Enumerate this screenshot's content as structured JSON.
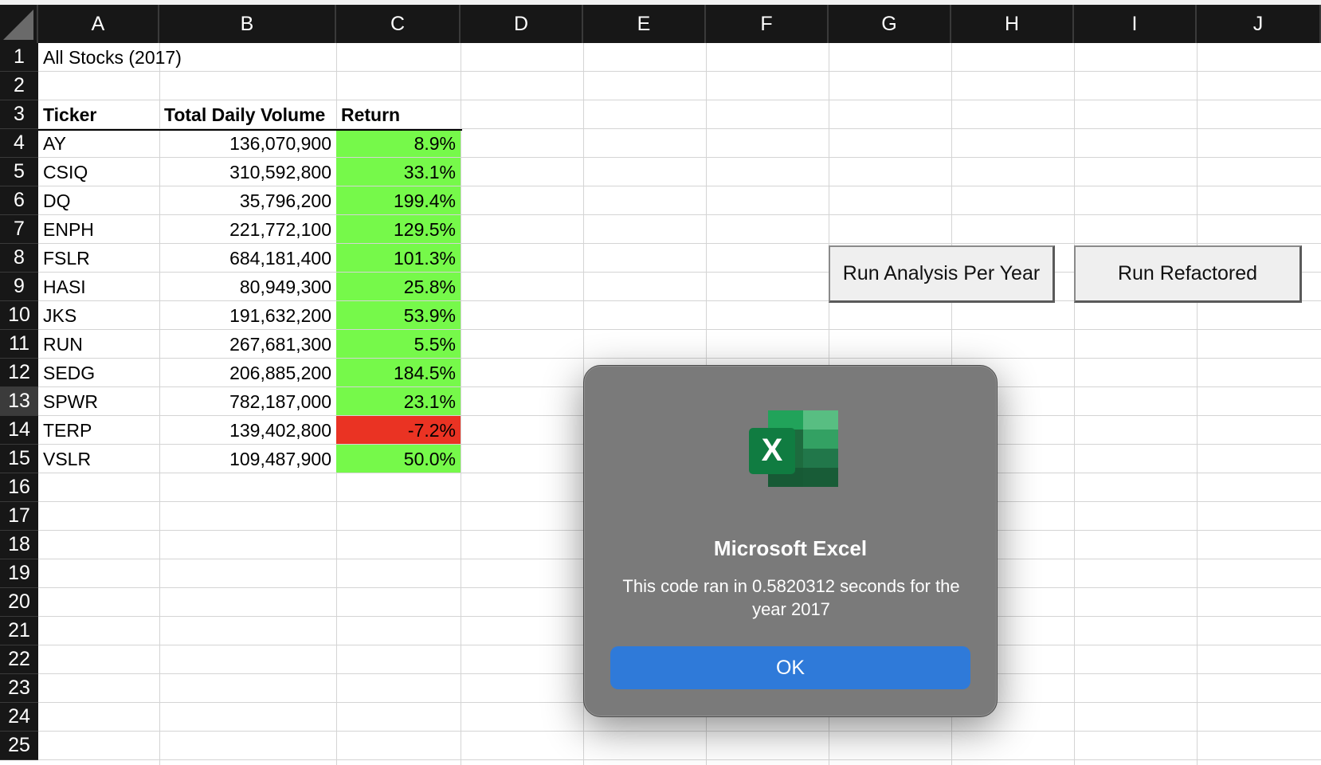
{
  "columns": [
    "A",
    "B",
    "C",
    "D",
    "E",
    "F",
    "G",
    "H",
    "I",
    "J"
  ],
  "rows": [
    "1",
    "2",
    "3",
    "4",
    "5",
    "6",
    "7",
    "8",
    "9",
    "10",
    "11",
    "12",
    "13",
    "14",
    "15",
    "16",
    "17",
    "18",
    "19",
    "20",
    "21",
    "22",
    "23",
    "24",
    "25"
  ],
  "active_row": "13",
  "sheet": {
    "title": "All Stocks (2017)",
    "headers": {
      "ticker": "Ticker",
      "volume": "Total Daily Volume",
      "return": "Return"
    },
    "stocks": [
      {
        "ticker": "AY",
        "volume": "136,070,900",
        "return": "8.9%",
        "status": "positive"
      },
      {
        "ticker": "CSIQ",
        "volume": "310,592,800",
        "return": "33.1%",
        "status": "positive"
      },
      {
        "ticker": "DQ",
        "volume": "35,796,200",
        "return": "199.4%",
        "status": "positive"
      },
      {
        "ticker": "ENPH",
        "volume": "221,772,100",
        "return": "129.5%",
        "status": "positive"
      },
      {
        "ticker": "FSLR",
        "volume": "684,181,400",
        "return": "101.3%",
        "status": "positive"
      },
      {
        "ticker": "HASI",
        "volume": "80,949,300",
        "return": "25.8%",
        "status": "positive"
      },
      {
        "ticker": "JKS",
        "volume": "191,632,200",
        "return": "53.9%",
        "status": "positive"
      },
      {
        "ticker": "RUN",
        "volume": "267,681,300",
        "return": "5.5%",
        "status": "positive"
      },
      {
        "ticker": "SEDG",
        "volume": "206,885,200",
        "return": "184.5%",
        "status": "positive"
      },
      {
        "ticker": "SPWR",
        "volume": "782,187,000",
        "return": "23.1%",
        "status": "positive"
      },
      {
        "ticker": "TERP",
        "volume": "139,402,800",
        "return": "-7.2%",
        "status": "negative"
      },
      {
        "ticker": "VSLR",
        "volume": "109,487,900",
        "return": "50.0%",
        "status": "positive"
      }
    ]
  },
  "buttons": {
    "run_analysis": "Run Analysis Per Year",
    "run_refactored": "Run Refactored"
  },
  "dialog": {
    "title": "Microsoft Excel",
    "message": "This code ran in 0.5820312 seconds for the year 2017",
    "ok_label": "OK",
    "icon": "excel-icon"
  },
  "colors": {
    "positive_fill": "#76f94a",
    "negative_fill": "#ea3323",
    "header_bg": "#171717",
    "dialog_bg": "#7a7a7a",
    "ok_button": "#2f7ad9"
  }
}
